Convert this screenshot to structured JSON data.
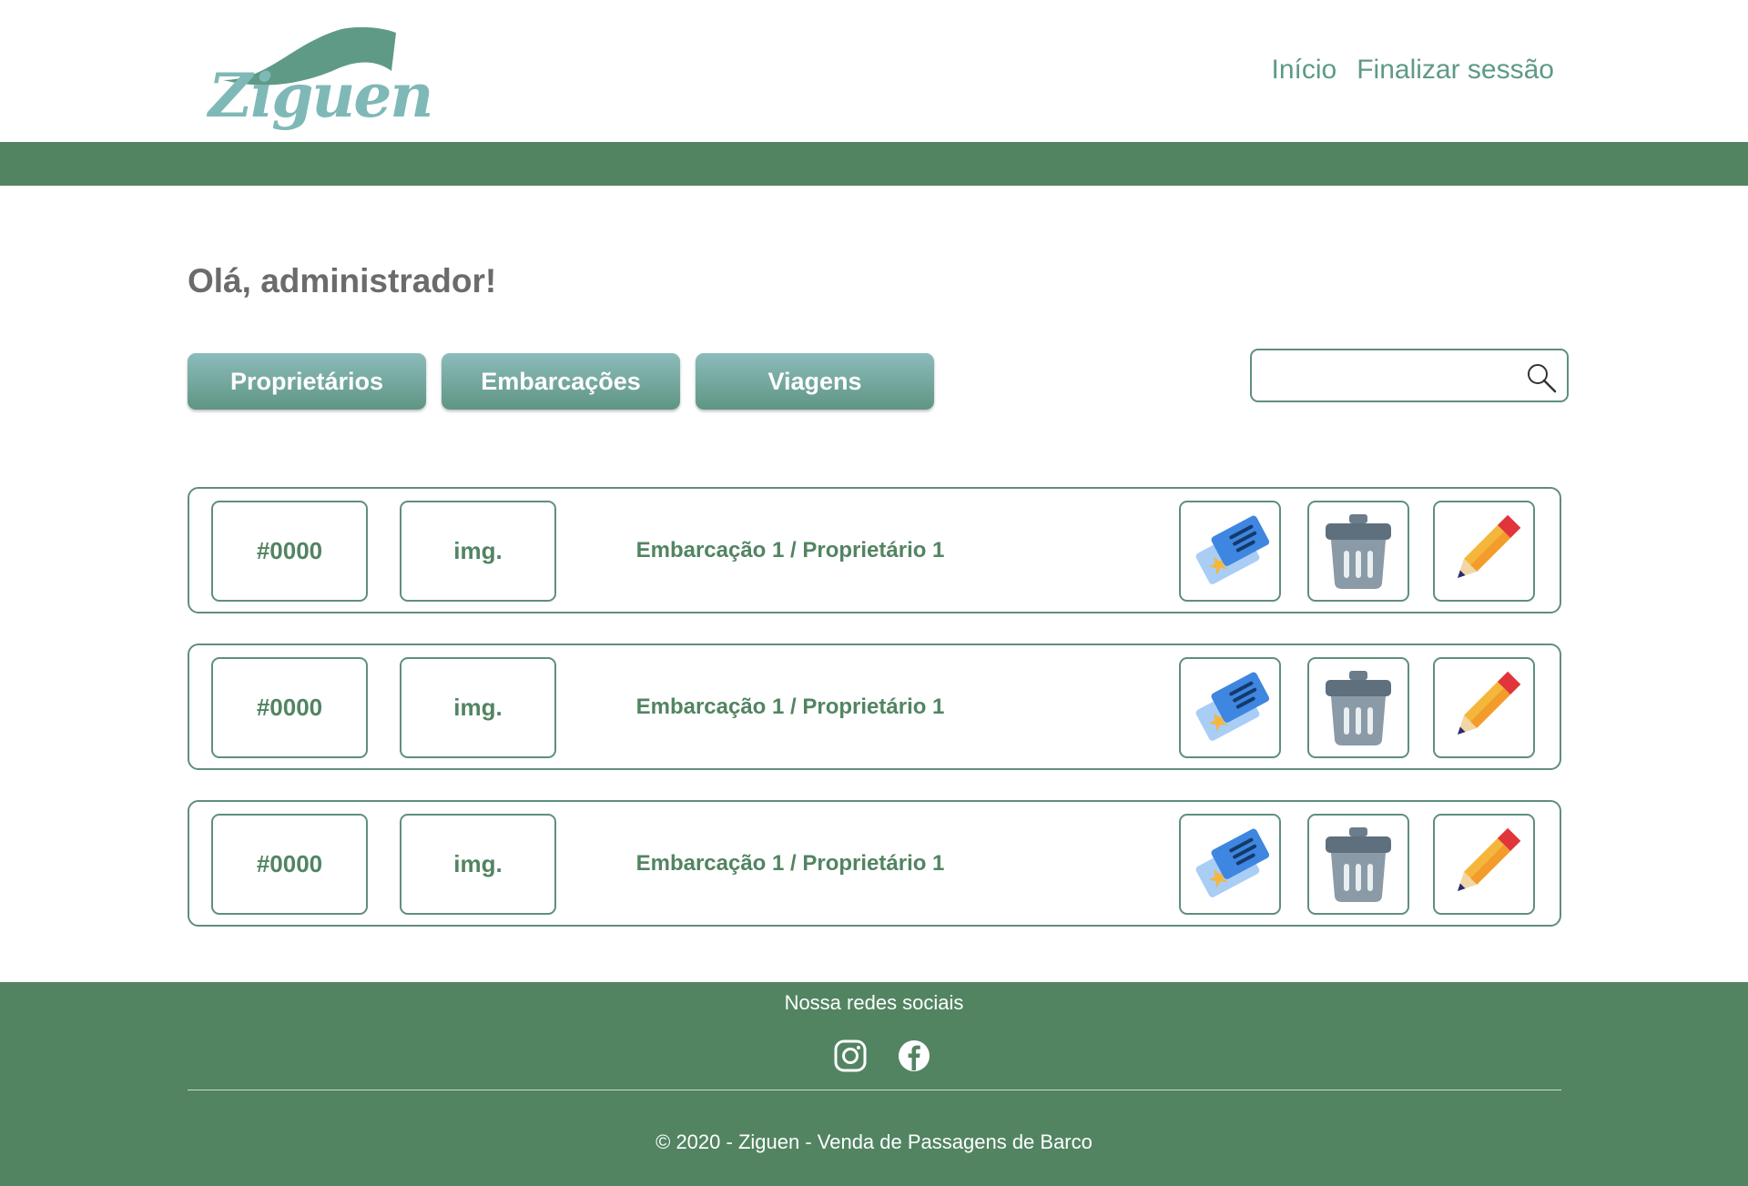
{
  "header": {
    "logo_text": "Ziguen",
    "nav": {
      "home_label": "Início",
      "logout_label": "Finalizar sessão"
    }
  },
  "colors": {
    "brand_green": "#528462",
    "accent_teal": "#7fb9b7",
    "tab_gradient_top": "#8cbcbb",
    "tab_gradient_bottom": "#5f9584"
  },
  "main": {
    "greeting": "Olá, administrador!",
    "tabs": [
      {
        "label": "Proprietários"
      },
      {
        "label": "Embarcações"
      },
      {
        "label": "Viagens"
      }
    ],
    "search": {
      "value": "",
      "placeholder": ""
    },
    "rows": [
      {
        "id": "#0000",
        "image": "img.",
        "title": "Embarcação 1 / Proprietário 1"
      },
      {
        "id": "#0000",
        "image": "img.",
        "title": "Embarcação 1 / Proprietário 1"
      },
      {
        "id": "#0000",
        "image": "img.",
        "title": "Embarcação 1 / Proprietário 1"
      }
    ],
    "row_actions": [
      "ticket-icon",
      "trash-icon",
      "pencil-icon"
    ]
  },
  "footer": {
    "social_heading": "Nossa redes sociais",
    "social_icons": [
      "instagram-icon",
      "facebook-icon"
    ],
    "copyright": "© 2020 - Ziguen - Venda de Passagens de Barco"
  }
}
